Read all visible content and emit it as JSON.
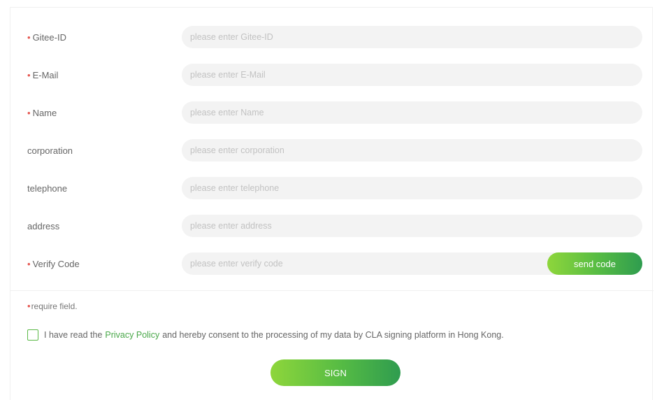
{
  "form": {
    "fields": [
      {
        "required": true,
        "label": "Gitee-ID",
        "placeholder": "please enter Gitee-ID"
      },
      {
        "required": true,
        "label": "E-Mail",
        "placeholder": "please enter E-Mail"
      },
      {
        "required": true,
        "label": "Name",
        "placeholder": "please enter Name"
      },
      {
        "required": false,
        "label": "corporation",
        "placeholder": "please enter corporation"
      },
      {
        "required": false,
        "label": "telephone",
        "placeholder": "please enter telephone"
      },
      {
        "required": false,
        "label": "address",
        "placeholder": "please enter address"
      },
      {
        "required": true,
        "label": "Verify Code",
        "placeholder": "please enter verify code"
      }
    ],
    "required_marker": "•",
    "send_code_label": "send code",
    "require_note": "require field.",
    "consent": {
      "checked": false,
      "text_before": "I have read the",
      "link_text": "Privacy Policy",
      "text_after": "and hereby consent to the processing of my data by CLA signing platform in Hong Kong."
    },
    "sign_label": "SIGN"
  },
  "colors": {
    "accent_start": "#8ed63b",
    "accent_end": "#2f9c4f",
    "required": "#e5554f",
    "link": "#4aa84a"
  }
}
